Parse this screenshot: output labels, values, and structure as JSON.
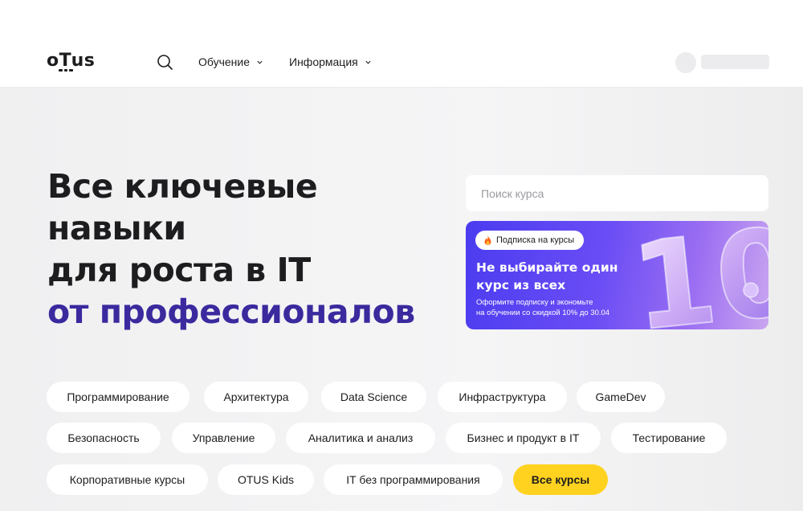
{
  "header": {
    "logo": "OTUS",
    "nav": [
      {
        "label": "Обучение"
      },
      {
        "label": "Информация"
      }
    ]
  },
  "hero": {
    "headline_lines": [
      "Все ключевые",
      "навыки",
      "для роста в IT"
    ],
    "headline_accent": "от профессионалов",
    "accent_color": "#3a2a9e"
  },
  "search": {
    "placeholder": "Поиск курса"
  },
  "banner": {
    "pill_icon": "fire-icon",
    "pill_label": "Подписка на курсы",
    "title": "Не выбирайте один курс из всех",
    "subtitle_line1": "Оформите подписку и экономьте",
    "subtitle_line2": "на обучении со скидкой 10% до 30.04",
    "big_number": "10"
  },
  "categories": [
    "Программирование",
    "Архитектура",
    "Data Science",
    "Инфраструктура",
    "GameDev",
    "Безопасность",
    "Управление",
    "Аналитика и анализ",
    "Бизнес и продукт в IT",
    "Тестирование",
    "Корпоративные курсы",
    "OTUS Kids",
    "IT без программирования",
    "Все курсы"
  ],
  "colors": {
    "all_courses_bg": "#ffd21f",
    "banner_start": "#4b3cf0",
    "banner_end": "#c9a6f0"
  }
}
